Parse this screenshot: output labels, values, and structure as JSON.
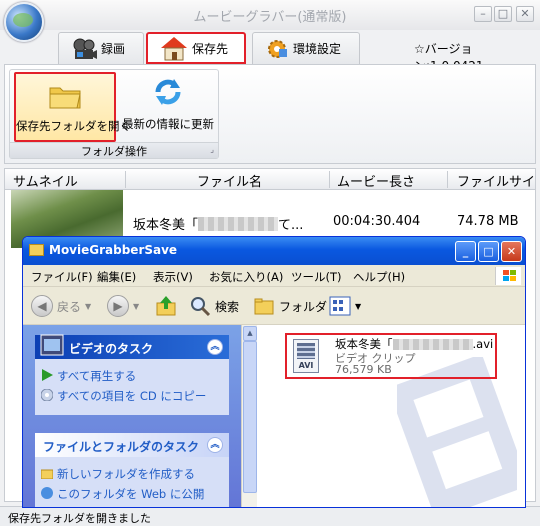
{
  "app": {
    "title": "ムービーグラバー(通常版)",
    "version": "バージョン:1.0.0421",
    "tabs": [
      {
        "label": "録画",
        "icon": "film-reel-icon"
      },
      {
        "label": "保存先",
        "icon": "house-icon",
        "active": true
      },
      {
        "label": "環境設定",
        "icon": "gear-icon"
      }
    ],
    "ribbon": {
      "group_label": "フォルダ操作",
      "open_folder_label": "保存先フォルダを開く",
      "refresh_label": "最新の情報に更新"
    },
    "list": {
      "columns": [
        "サムネイル",
        "ファイル名",
        "ムービー長さ",
        "ファイルサイ"
      ],
      "rows": [
        {
          "filename": "坂本冬美「",
          "filename_tail": "て...",
          "duration": "00:04:30.404",
          "size": "74.78 MB"
        }
      ]
    },
    "status": "保存先フォルダを開きました"
  },
  "explorer": {
    "title": "MovieGrabberSave",
    "menu": [
      "ファイル(F)",
      "編集(E)",
      "表示(V)",
      "お気に入り(A)",
      "ツール(T)",
      "ヘルプ(H)"
    ],
    "toolbar": {
      "back": "戻る",
      "search": "検索",
      "folders": "フォルダ"
    },
    "video_tasks": {
      "header": "ビデオのタスク",
      "items": [
        "すべて再生する",
        "すべての項目を CD にコピー"
      ]
    },
    "file_tasks": {
      "header": "ファイルとフォルダのタスク",
      "items": [
        "新しいフォルダを作成する",
        "このフォルダを Web に公開"
      ]
    },
    "file": {
      "name": "坂本冬美「",
      "ext": ".avi",
      "type": "ビデオ クリップ",
      "size": "76,579 KB",
      "icon_label": "AVI"
    }
  },
  "colors": {
    "highlight": "#e2202a",
    "xp_blue": "#0a58e0"
  }
}
